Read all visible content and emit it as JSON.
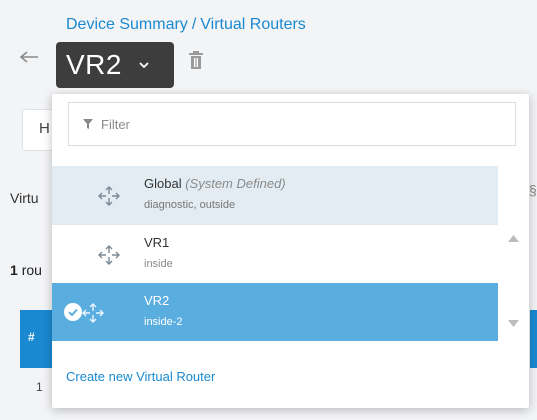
{
  "breadcrumb": {
    "parent": "Device Summary",
    "separator": "/",
    "current": "Virtual Routers"
  },
  "selector": {
    "value": "VR2"
  },
  "background": {
    "tab_label": "H",
    "section_label": "Virtu",
    "count_prefix": "1",
    "count_suffix": "rou",
    "table_hash": "#",
    "row_number": "1",
    "right_glyph": "§"
  },
  "dropdown": {
    "filter_placeholder": "Filter",
    "options": [
      {
        "name": "Global",
        "note": "(System Defined)",
        "interfaces": "diagnostic, outside",
        "selected": false
      },
      {
        "name": "VR1",
        "interfaces": "inside",
        "selected": false
      },
      {
        "name": "VR2",
        "interfaces": "inside-2",
        "selected": true
      }
    ],
    "create_label": "Create new Virtual Router"
  },
  "icons": {
    "back": "back-arrow-icon",
    "chevron": "chevron-down-icon",
    "trash": "trash-icon",
    "filter": "filter-icon",
    "router": "router-icon",
    "check": "check-circle-icon"
  },
  "colors": {
    "accent": "#1a89d1",
    "selected_row": "#5aaedf",
    "hover_row": "#e3ecf3",
    "select_bg": "#3d3d3d"
  }
}
